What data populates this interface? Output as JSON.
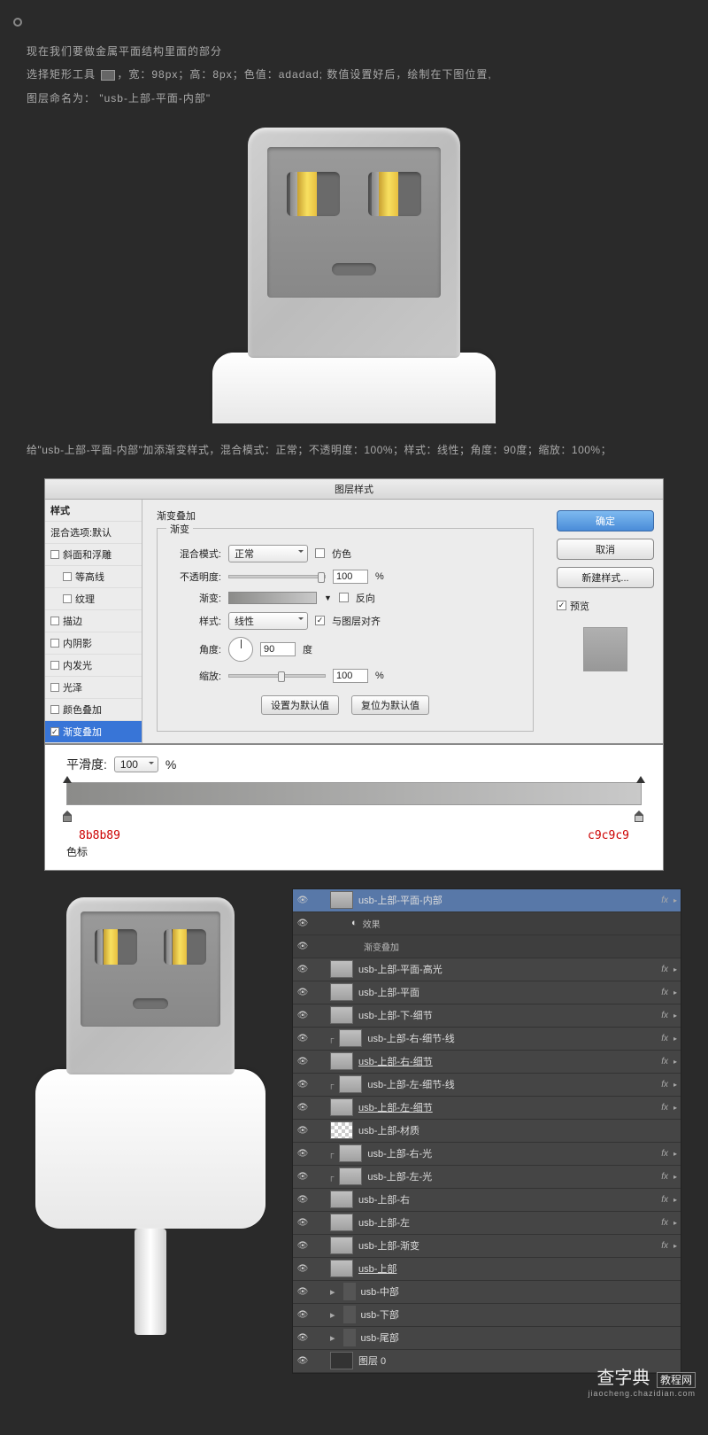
{
  "intro": {
    "line1": "现在我们要做金属平面结构里面的部分",
    "line2_a": "选择矩形工具 ",
    "line2_b": "，宽：98px；高：8px；色值：adadad; 数值设置好后，绘制在下图位置,",
    "line3": "图层命名为： \"usb-上部-平面-内部\""
  },
  "desc2": "给\"usb-上部-平面-内部\"加添渐变样式，混合模式：正常；不透明度：100%；样式：线性；角度：90度；缩放：100%；",
  "dialog": {
    "title": "图层样式",
    "left": {
      "header": "样式",
      "blend": "混合选项:默认",
      "items": [
        "斜面和浮雕",
        "等高线",
        "纹理",
        "描边",
        "内阴影",
        "内发光",
        "光泽",
        "颜色叠加",
        "渐变叠加"
      ]
    },
    "mid": {
      "section": "渐变叠加",
      "sub": "渐变",
      "blendMode": "混合模式:",
      "blendModeVal": "正常",
      "dither": "仿色",
      "opacity": "不透明度:",
      "opacityVal": "100",
      "pct": "%",
      "gradient": "渐变:",
      "reverse": "反向",
      "style": "样式:",
      "styleVal": "线性",
      "align": "与图层对齐",
      "angle": "角度:",
      "angleVal": "90",
      "deg": "度",
      "scale": "缩放:",
      "scaleVal": "100",
      "btnDefault": "设置为默认值",
      "btnReset": "复位为默认值"
    },
    "right": {
      "ok": "确定",
      "cancel": "取消",
      "newStyle": "新建样式...",
      "preview": "预览"
    }
  },
  "gradEdit": {
    "smooth": "平滑度:",
    "smoothVal": "100",
    "pct": "%",
    "stopL": "8b8b89",
    "stopR": "c9c9c9",
    "setai": "色标"
  },
  "layers": [
    {
      "name": "usb-上部-平面-内部",
      "fx": true,
      "sel": true,
      "thumb": "norm"
    },
    {
      "name": "效果",
      "sub": true,
      "eyeOnly": true,
      "indent": 1
    },
    {
      "name": "渐变叠加",
      "sub": true,
      "eyeOnly": true,
      "indent": 2
    },
    {
      "name": "usb-上部-平面-高光",
      "fx": true,
      "thumb": "norm"
    },
    {
      "name": "usb-上部-平面",
      "fx": true,
      "thumb": "norm"
    },
    {
      "name": "usb-上部-下-细节",
      "fx": true,
      "thumb": "norm"
    },
    {
      "name": "usb-上部-右-细节-线",
      "fx": true,
      "thumb": "norm",
      "clipped": true
    },
    {
      "name": "usb-上部-右-细节",
      "fx": true,
      "thumb": "norm",
      "ul": true
    },
    {
      "name": "usb-上部-左-细节-线",
      "fx": true,
      "thumb": "norm",
      "clipped": true
    },
    {
      "name": "usb-上部-左-细节",
      "fx": true,
      "thumb": "norm",
      "ul": true
    },
    {
      "name": "usb-上部-材质",
      "thumb": "transp"
    },
    {
      "name": "usb-上部-右-光",
      "fx": true,
      "thumb": "norm",
      "clipped": true
    },
    {
      "name": "usb-上部-左-光",
      "fx": true,
      "thumb": "norm",
      "clipped": true
    },
    {
      "name": "usb-上部-右",
      "fx": true,
      "thumb": "norm"
    },
    {
      "name": "usb-上部-左",
      "fx": true,
      "thumb": "norm"
    },
    {
      "name": "usb-上部-渐变",
      "fx": true,
      "thumb": "norm"
    },
    {
      "name": "usb-上部",
      "thumb": "norm",
      "ul": true
    },
    {
      "name": "usb-中部",
      "folder": true
    },
    {
      "name": "usb-下部",
      "folder": true
    },
    {
      "name": "usb-尾部",
      "folder": true
    },
    {
      "name": "图层 0",
      "thumb": "dark"
    }
  ],
  "watermark": {
    "main": "查字典",
    "sub": "jiaocheng.chazidian.com",
    "tag": "教程网"
  }
}
